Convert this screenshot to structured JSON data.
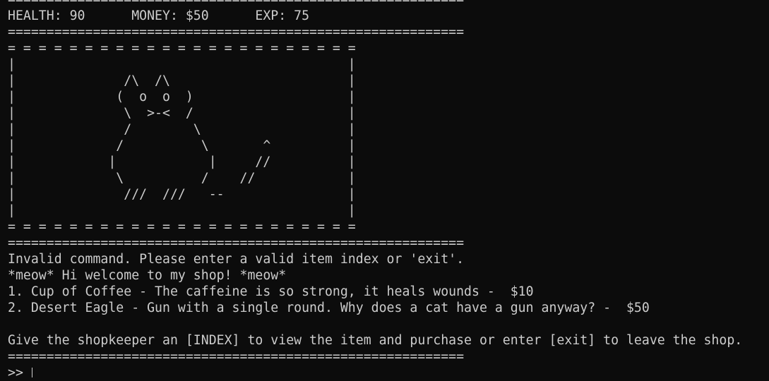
{
  "terminal": {
    "top_rule": "===========================================================",
    "stats": {
      "health": "HEALTH: 90",
      "money": "MONEY: $50",
      "exp": "EXP: 75",
      "line": "HEALTH: 90      MONEY: $50      EXP: 75"
    },
    "stats_rule": "===========================================================",
    "art": [
      "= = = = = = = = = = = = = = = = = = = = = = =",
      "|                                           |",
      "|              /\\  /\\                       |",
      "|             (  o  o  )                    |",
      "|              \\  >-<  /                    |",
      "|              /        \\                   |",
      "|             /          \\       ^          |",
      "|            |            |     //          |",
      "|             \\          /    //            |",
      "|              ///  ///   --                |",
      "|                                           |",
      "= = = = = = = = = = = = = = = = = = = = = = ="
    ],
    "art_rule": "===========================================================",
    "messages": [
      "Invalid command. Please enter a valid item index or 'exit'.",
      "*meow* Hi welcome to my shop! *meow*",
      "1. Cup of Coffee - The caffeine is so strong, it heals wounds -  $10",
      "2. Desert Eagle - Gun with a single round. Why does a cat have a gun anyway? -  $50",
      "",
      "Give the shopkeeper an [INDEX] to view the item and purchase or enter [exit] to leave the shop."
    ],
    "bottom_rule": "===========================================================",
    "prompt": ">> "
  }
}
